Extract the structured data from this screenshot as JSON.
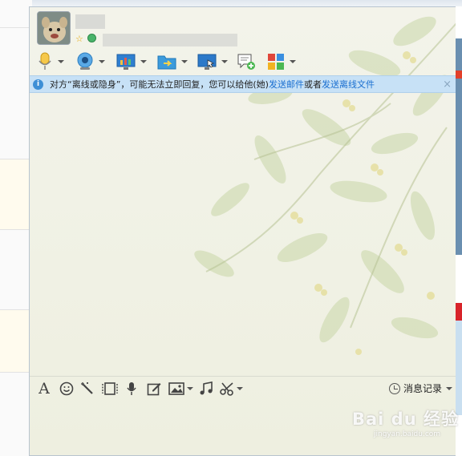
{
  "window": {
    "notice": {
      "info_glyph": "i",
      "prefix": "对方“离线或隐身”，可能无法立即回复，您可以给他(她)",
      "link1": "发送邮件",
      "middle": "或者",
      "link2": "发送离线文件",
      "close": "×"
    },
    "title": {
      "star": "☆"
    },
    "toolbar_icons": [
      "microphone-icon",
      "webcam-icon",
      "screen-share-icon",
      "file-transfer-icon",
      "remote-desktop-icon",
      "add-chat-icon",
      "apps-icon"
    ],
    "input_toolbar_icons": [
      "font-icon",
      "emoji-icon",
      "magic-wand-icon",
      "video-icon",
      "voice-icon",
      "edit-icon",
      "image-icon",
      "music-icon",
      "scissors-icon"
    ],
    "input_toolbar": {
      "font_glyph": "A",
      "history_label": "消息记录"
    }
  },
  "watermark": {
    "text": "Bai du 经验",
    "sub": "jingyan.baidu.com"
  },
  "colors": {
    "notice_bg": "#c7e1f6",
    "link": "#1a6fd0",
    "window_bg": "#f2f2e8"
  }
}
